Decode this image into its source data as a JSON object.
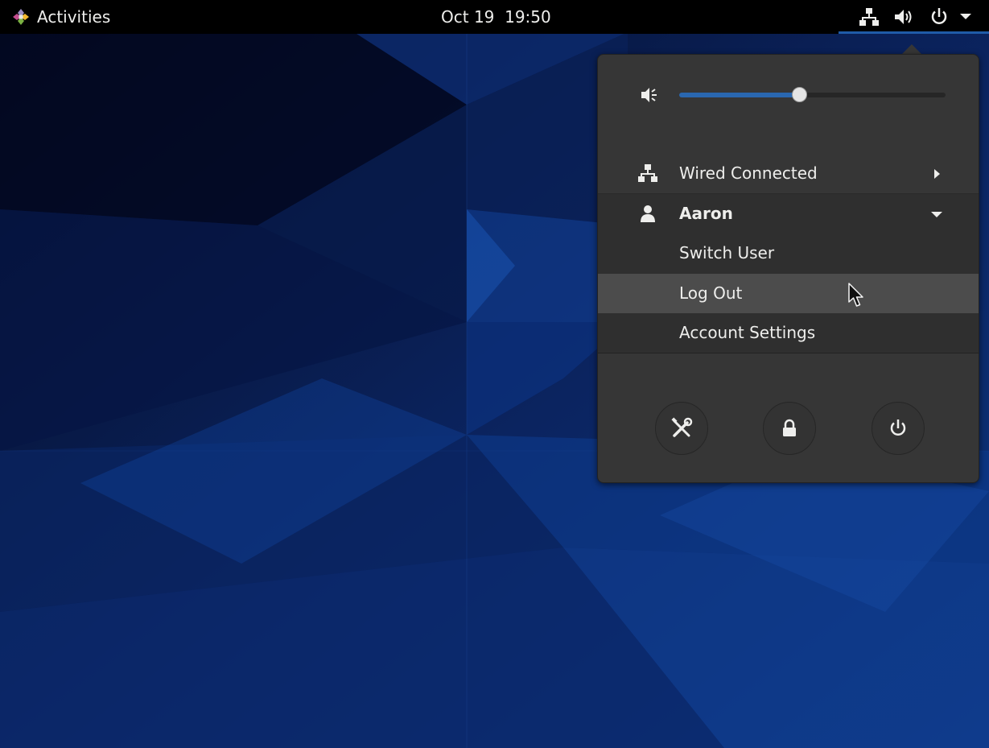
{
  "topbar": {
    "activities_label": "Activities",
    "clock": "Oct 19  19:50",
    "tray_icons": [
      "network-wired-icon",
      "volume-high-icon",
      "power-icon",
      "menu-dropdown-icon"
    ]
  },
  "menu": {
    "volume": {
      "icon": "volume-muted-icon",
      "level_fraction": 0.45
    },
    "network": {
      "icon": "network-wired-icon",
      "label": "Wired Connected",
      "arrow": "chevron-right-icon"
    },
    "user": {
      "icon": "user-icon",
      "name": "Aaron",
      "arrow": "chevron-down-icon",
      "items": [
        {
          "label": "Switch User"
        },
        {
          "label": "Log Out"
        },
        {
          "label": "Account Settings"
        }
      ]
    },
    "bottom_buttons": [
      "settings-icon",
      "lock-icon",
      "power-icon"
    ]
  },
  "colors": {
    "topbar_bg": "#000000",
    "menu_bg": "#363636",
    "menu_user_section_bg": "#2f2f2f",
    "highlight_bg": "#4c4c4c",
    "accent": "#2a67b0",
    "text": "#eeeeec",
    "wallpaper_base": "#0a1a3e"
  }
}
